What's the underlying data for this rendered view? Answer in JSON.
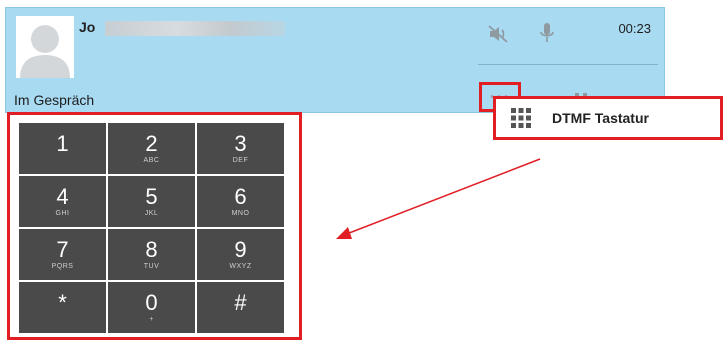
{
  "call": {
    "caller_name": "Jo",
    "status": "Im Gespräch",
    "timer": "00:23"
  },
  "popup": {
    "label": "DTMF Tastatur"
  },
  "more_button": {
    "label": "···"
  },
  "keypad": {
    "keys": [
      {
        "digit": "1",
        "letters": ""
      },
      {
        "digit": "2",
        "letters": "ABC"
      },
      {
        "digit": "3",
        "letters": "DEF"
      },
      {
        "digit": "4",
        "letters": "GHI"
      },
      {
        "digit": "5",
        "letters": "JKL"
      },
      {
        "digit": "6",
        "letters": "MNO"
      },
      {
        "digit": "7",
        "letters": "PQRS"
      },
      {
        "digit": "8",
        "letters": "TUV"
      },
      {
        "digit": "9",
        "letters": "WXYZ"
      },
      {
        "digit": "*",
        "letters": ""
      },
      {
        "digit": "0",
        "letters": "+"
      },
      {
        "digit": "#",
        "letters": ""
      }
    ]
  },
  "icons": {
    "speaker": "speaker-muted-icon",
    "mic": "microphone-icon",
    "transfer": "transfer-icon",
    "hold": "pause-icon",
    "hangup": "hangup-icon",
    "dialpad": "dialpad-grid-icon",
    "avatar": "user-avatar-icon"
  },
  "colors": {
    "panel_bg": "#a8daf1",
    "highlight": "#e01e24",
    "key_bg": "#4a4a4a",
    "icon_gray": "#9aa4aa"
  }
}
